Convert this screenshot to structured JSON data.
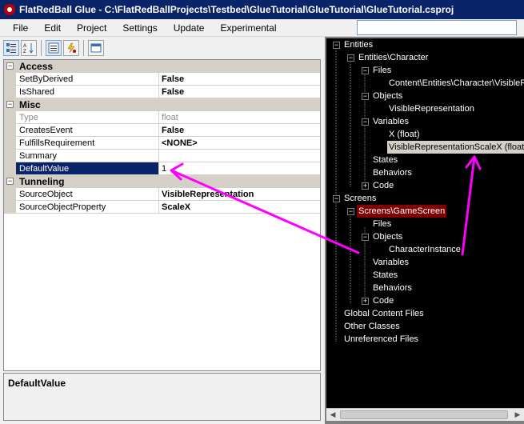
{
  "window": {
    "title": "FlatRedBall Glue - C:\\FlatRedBallProjects\\Testbed\\GlueTutorial\\GlueTutorial\\GlueTutorial.csproj"
  },
  "menu": [
    "File",
    "Edit",
    "Project",
    "Settings",
    "Update",
    "Experimental"
  ],
  "search": {
    "value": ""
  },
  "toolbar": [
    "categorized-icon",
    "alphabetical-icon",
    "properties-icon",
    "events-icon",
    "property-pages-icon"
  ],
  "grid": {
    "categories": [
      {
        "label": "Access",
        "toggle": "⊟",
        "props": [
          {
            "name": "SetByDerived",
            "value": "False"
          },
          {
            "name": "IsShared",
            "value": "False"
          }
        ]
      },
      {
        "label": "Misc",
        "toggle": "⊟",
        "props": [
          {
            "name": "Type",
            "value": "float"
          },
          {
            "name": "CreatesEvent",
            "value": "False"
          },
          {
            "name": "FulfillsRequirement",
            "value": "<NONE>"
          },
          {
            "name": "Summary",
            "value": ""
          },
          {
            "name": "DefaultValue",
            "value": "1"
          }
        ]
      },
      {
        "label": "Tunneling",
        "toggle": "⊟",
        "props": [
          {
            "name": "SourceObject",
            "value": "VisibleRepresentation"
          },
          {
            "name": "SourceObjectProperty",
            "value": "ScaleX"
          }
        ]
      }
    ]
  },
  "description": {
    "title": "DefaultValue"
  },
  "tree": {
    "entities": "Entities",
    "character": "Entities\\Character",
    "files": "Files",
    "files_child": "Content\\Entities\\Character\\VisibleR",
    "objects": "Objects",
    "visible_rep": "VisibleRepresentation",
    "variables": "Variables",
    "var_x": "X (float)",
    "var_scalex": "VisibleRepresentationScaleX (float)",
    "states": "States",
    "behaviors": "Behaviors",
    "code": "Code",
    "screens": "Screens",
    "gamescreen": "Screens\\GameScreen",
    "gs_files": "Files",
    "gs_objects": "Objects",
    "gs_instance": "CharacterInstance",
    "gs_variables": "Variables",
    "gs_states": "States",
    "gs_behaviors": "Behaviors",
    "gs_code": "Code",
    "global_content": "Global Content Files",
    "other_classes": "Other Classes",
    "unreferenced": "Unreferenced Files"
  },
  "colors": {
    "titlebar": "#0a246a",
    "selection": "#0a246a",
    "tree_selected": "#800000",
    "arrow": "#ff00ff"
  }
}
